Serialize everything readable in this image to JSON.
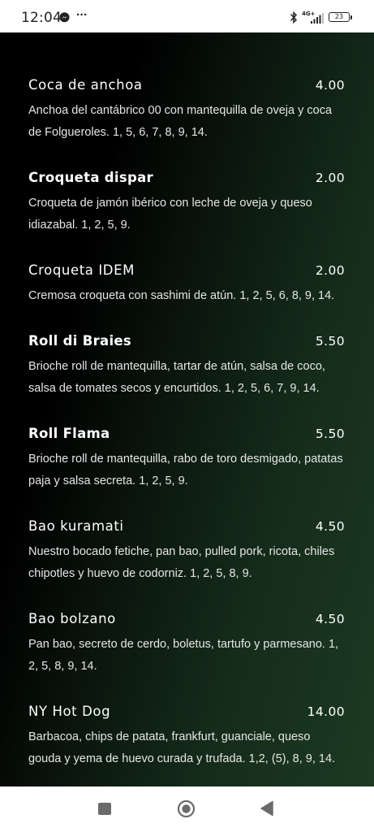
{
  "status_bar": {
    "time": "12:04",
    "more": "···",
    "network": "4G+",
    "battery": "23"
  },
  "menu": {
    "items": [
      {
        "name": "Coca de anchoa",
        "price": "4.00",
        "description": "Anchoa del cantábrico 00 con mantequilla de oveja y coca de Folgueroles. 1, 5, 6, 7, 8, 9, 14."
      },
      {
        "name": "Croqueta dispar",
        "price": "2.00",
        "description": "Croqueta de jamón ibérico con leche de oveja y queso idiazabal. 1, 2, 5, 9."
      },
      {
        "name": "Croqueta IDEM",
        "price": "2.00",
        "description": "Cremosa croqueta con sashimi de atún. 1, 2, 5, 6, 8, 9, 14."
      },
      {
        "name": "Roll di Braies",
        "price": "5.50",
        "description": "Brioche roll de mantequilla, tartar de atún, salsa de coco, salsa de tomates secos y encurtidos. 1, 2, 5, 6, 7, 9, 14."
      },
      {
        "name": "Roll Flama",
        "price": "5.50",
        "description": "Brioche roll de mantequilla, rabo de toro desmigado, patatas paja y salsa secreta. 1, 2, 5, 9."
      },
      {
        "name": "Bao kuramati",
        "price": "4.50",
        "description": "Nuestro bocado fetiche, pan bao, pulled pork, ricota, chiles chipotles y huevo de codorniz. 1, 2, 5, 8, 9."
      },
      {
        "name": "Bao bolzano",
        "price": "4.50",
        "description": "Pan bao, secreto de cerdo, boletus, tartufo y parmesano. 1, 2, 5, 8, 9, 14."
      },
      {
        "name": "NY Hot Dog",
        "price": "14.00",
        "description": "Barbacoa, chips de patata, frankfurt, guanciale, queso gouda y yema de huevo curada y trufada. 1,2, (5), 8, 9, 14."
      }
    ]
  },
  "nav_bar": {
    "icons": [
      "recents-icon",
      "home-icon",
      "back-icon"
    ]
  }
}
